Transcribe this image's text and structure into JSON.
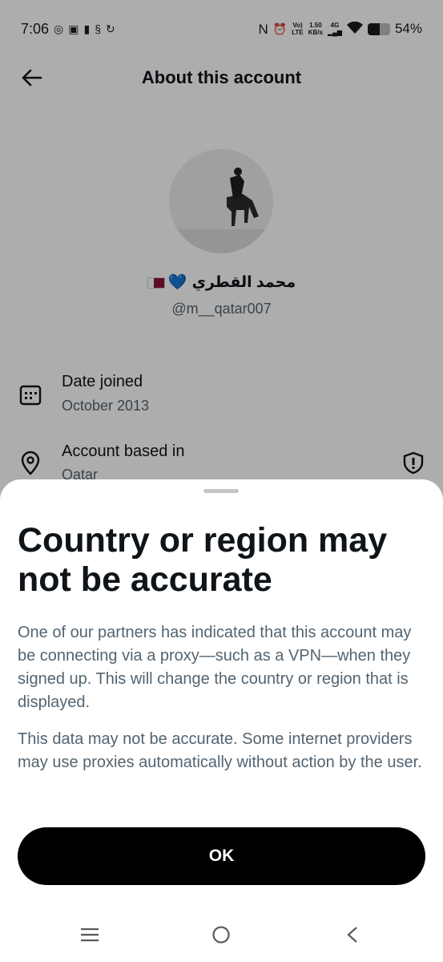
{
  "status_bar": {
    "time": "7:06",
    "left_icons": [
      "whatsapp-icon",
      "mail-icon",
      "sim-icon",
      "app-icon",
      "sync-icon"
    ],
    "net_badge": "N",
    "volte_top": "Vo)",
    "volte_bottom": "LTE",
    "speed_top": "1.50",
    "speed_bottom": "KB/s",
    "network_type": "4G",
    "battery_percent": "54%",
    "battery_level": 0.54
  },
  "header": {
    "title": "About this account",
    "back_icon": "arrow-left-icon"
  },
  "profile": {
    "display_name": "محمد القطري",
    "heart": "💙",
    "handle": "@m__qatar007"
  },
  "info": {
    "date_joined_label": "Date joined",
    "date_joined_value": "October 2013",
    "location_label": "Account based in",
    "location_value": "Qatar"
  },
  "sheet": {
    "title": "Country or region may not be accurate",
    "paragraph_1": "One of our partners has indicated that this account may be connecting via a proxy—such as a VPN—when they signed up. This will change the country or region that is displayed.",
    "paragraph_2": "This data may not be accurate. Some internet providers may use proxies automatically without action by the user.",
    "ok_label": "OK"
  },
  "nav": {
    "items": [
      "menu-icon",
      "home-circle-icon",
      "back-chevron-icon"
    ]
  },
  "colors": {
    "primary_text": "#0f1419",
    "secondary_text": "#536471",
    "button": "#000000",
    "heart": "#1d6fd8",
    "qatar_maroon": "#8a1538"
  }
}
